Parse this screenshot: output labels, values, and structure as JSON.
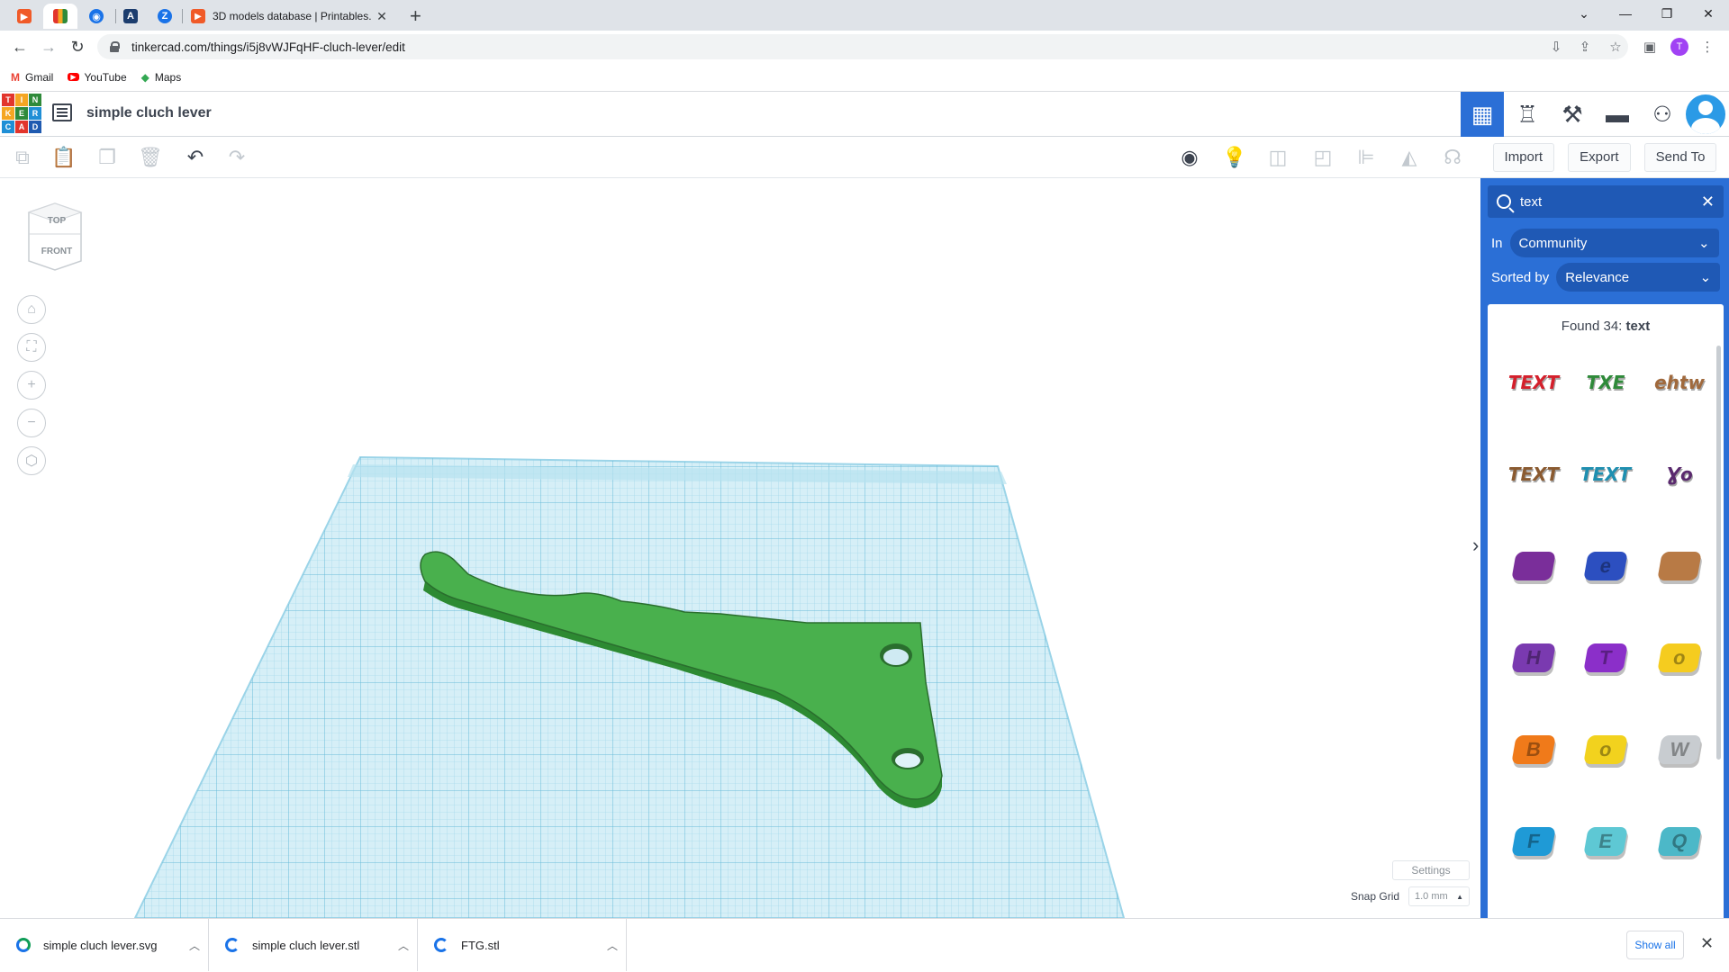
{
  "browser": {
    "active_tab_title": "3D models database | Printables.",
    "url": "tinkercad.com/things/i5j8vWJFqHF-cluch-lever/edit",
    "profile_initial": "T",
    "bookmarks": [
      {
        "label": "Gmail",
        "icon": "gmail-icon"
      },
      {
        "label": "YouTube",
        "icon": "youtube-icon"
      },
      {
        "label": "Maps",
        "icon": "maps-icon"
      }
    ]
  },
  "header": {
    "logo_letters": [
      "T",
      "I",
      "N",
      "K",
      "E",
      "R",
      "C",
      "A",
      "D"
    ],
    "design_title": "simple cluch lever"
  },
  "right_tabs": {
    "import": "Import",
    "export": "Export",
    "send_to": "Send To"
  },
  "viewcube": {
    "top": "TOP",
    "front": "FRONT"
  },
  "workspace": {
    "settings_label": "Settings",
    "snap_grid_label": "Snap Grid",
    "snap_grid_value": "1.0 mm"
  },
  "panel": {
    "search_value": "text",
    "in_label": "In",
    "in_value": "Community",
    "sorted_label": "Sorted by",
    "sorted_value": "Relevance",
    "found_prefix": "Found 34:",
    "found_query": "text",
    "shapes": [
      {
        "kind": "text",
        "label": "TEXT",
        "color": "#d4202c"
      },
      {
        "kind": "text",
        "label": "TXE",
        "color": "#2f8a3a"
      },
      {
        "kind": "text",
        "label": "ehtw",
        "color": "#a0693c"
      },
      {
        "kind": "text",
        "label": "TEXT",
        "color": "#8a5a30"
      },
      {
        "kind": "text",
        "label": "TEXT",
        "color": "#1f8fb0"
      },
      {
        "kind": "text",
        "label": "Ɣo",
        "color": "#5a2a6e"
      },
      {
        "kind": "blob",
        "label": "",
        "color": "#7a2e9a"
      },
      {
        "kind": "blob",
        "label": "e",
        "color": "#2c4fc0"
      },
      {
        "kind": "blob",
        "label": "",
        "color": "#b87a45"
      },
      {
        "kind": "blob",
        "label": "H",
        "color": "#7a3ab0"
      },
      {
        "kind": "blob",
        "label": "T",
        "color": "#8b2fc9"
      },
      {
        "kind": "blob",
        "label": "o",
        "color": "#f5cc1f"
      },
      {
        "kind": "blob",
        "label": "B",
        "color": "#f07a1a"
      },
      {
        "kind": "blob",
        "label": "o",
        "color": "#f2d21e"
      },
      {
        "kind": "blob",
        "label": "W",
        "color": "#c8ccd0"
      },
      {
        "kind": "blob",
        "label": "F",
        "color": "#1f9ad6"
      },
      {
        "kind": "blob",
        "label": "E",
        "color": "#5ec8d4"
      },
      {
        "kind": "blob",
        "label": "Q",
        "color": "#4cb8c8"
      }
    ]
  },
  "downloads": {
    "items": [
      "simple cluch lever.svg",
      "simple cluch lever.stl",
      "FTG.stl"
    ],
    "show_all": "Show all"
  }
}
